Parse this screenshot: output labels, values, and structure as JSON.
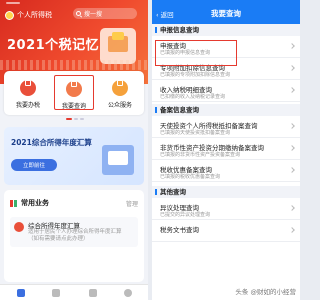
{
  "left": {
    "app_name": "个人所得税",
    "search_text": "搜一搜",
    "banner_title": "2021个税记忆",
    "services": [
      {
        "label": "我要办税"
      },
      {
        "label": "我要查询"
      },
      {
        "label": "公众服务"
      }
    ],
    "promo": {
      "title": "2021综合所得年度汇算",
      "button": "立即前往"
    },
    "common": {
      "title": "常用业务",
      "manage": "管理",
      "item_title": "综合所得年度汇算",
      "item_desc": "适用于居民个人办理综合所得年度汇算（如有需要请点此办理）"
    },
    "tabs": [
      {
        "icon": "home-icon"
      },
      {
        "icon": "service-icon"
      },
      {
        "icon": "doc-icon"
      },
      {
        "icon": "user-icon"
      }
    ]
  },
  "right": {
    "back": "返回",
    "title": "我要查询",
    "sections": [
      {
        "label": "申报信息查询"
      },
      {
        "label": "备案信息查询"
      },
      {
        "label": "其他查询"
      }
    ],
    "rows": [
      {
        "title": "申报查询",
        "desc": "已填报的申报信息查询"
      },
      {
        "title": "专项附加扣除信息查询",
        "desc": "已填报的专项附加扣除信息查询"
      },
      {
        "title": "收入纳税明细查询",
        "desc": "已扣缴的收入及纳税记录查询"
      },
      {
        "title": "天使投资个人所得税抵扣备案查询",
        "desc": "已填报的天使投资抵扣备案查询"
      },
      {
        "title": "非货币性资产投资分期缴纳备案查询",
        "desc": "已填报的非货币性资产投资备案查询"
      },
      {
        "title": "税收优惠备案查询",
        "desc": "已填报的税收优惠备案查询"
      },
      {
        "title": "异议处理查询",
        "desc": "已提交的异议处理查询"
      },
      {
        "title": "税务文书查询",
        "desc": ""
      }
    ]
  },
  "watermark": "头条 @财如的小经营",
  "colors": {
    "brand_red": "#e53a2f",
    "header_blue": "#1a7cf5",
    "highlight": "#e53a2f"
  }
}
